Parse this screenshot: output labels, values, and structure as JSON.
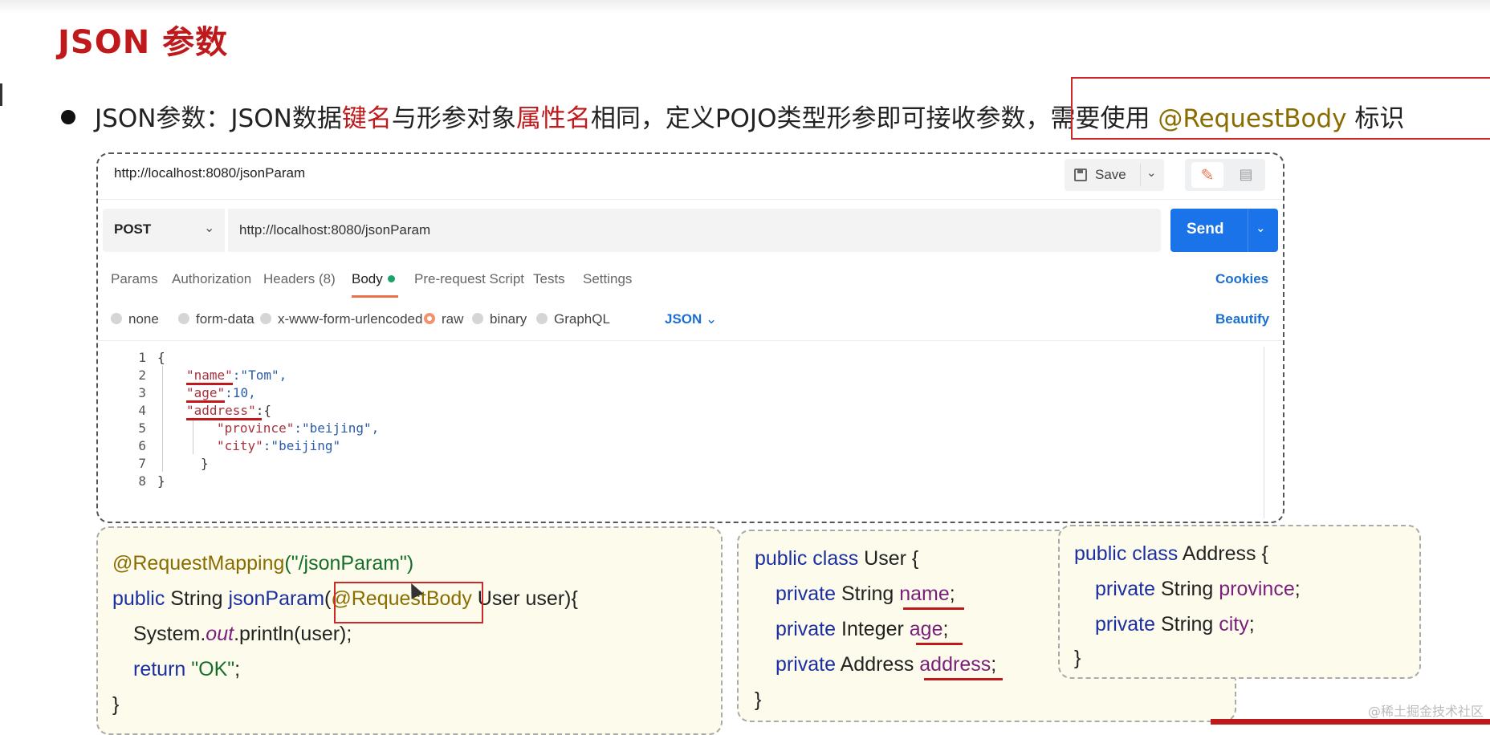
{
  "slide": {
    "title": "JSON 参数",
    "bullet": {
      "p1": "JSON参数：JSON数据",
      "p2": "键名",
      "p3": "与形参对象",
      "p4": "属性名",
      "p5": "相同，定义POJO类型形参即可接收参数，",
      "p6": "需要使用 ",
      "p7": "@RequestBody",
      "p8": " 标识"
    }
  },
  "postman": {
    "request_title": "http://localhost:8080/jsonParam",
    "save_label": "Save",
    "method": "POST",
    "url": "http://localhost:8080/jsonParam",
    "send_label": "Send",
    "tabs": [
      "Params",
      "Authorization",
      "Headers (8)",
      "Body",
      "Pre-request Script",
      "Tests",
      "Settings"
    ],
    "active_tab": "Body",
    "cookies_label": "Cookies",
    "body_types": [
      "none",
      "form-data",
      "x-www-form-urlencoded",
      "raw",
      "binary",
      "GraphQL"
    ],
    "selected_body_type": "raw",
    "format": "JSON",
    "beautify_label": "Beautify",
    "code_lines": [
      {
        "n": "1",
        "text": "{"
      },
      {
        "n": "2",
        "key": "\"name\"",
        "rest": ":\"Tom\","
      },
      {
        "n": "3",
        "key": "\"age\"",
        "rest": ":10,"
      },
      {
        "n": "4",
        "key": "\"address\"",
        "rest": ":{"
      },
      {
        "n": "5",
        "key": "\"province\"",
        "rest": ":\"beijing\","
      },
      {
        "n": "6",
        "key": "\"city\"",
        "rest": ":\"beijing\""
      },
      {
        "n": "7",
        "text": "}"
      },
      {
        "n": "8",
        "text": "}"
      }
    ]
  },
  "controller_code": {
    "l1_ann": "@RequestMapping",
    "l1_str": "(\"/jsonParam\")",
    "l2_kw": "public",
    "l2_type": " String ",
    "l2_fn": "jsonParam",
    "l2_paren": "(",
    "l2_ann": "@RequestBody",
    "l2_rest": " User user){",
    "l3_a": "System.",
    "l3_it": "out",
    "l3_b": ".println(user);",
    "l4_kw": "return",
    "l4_str": " \"OK\"",
    "l4_end": ";",
    "l5": "}"
  },
  "user_class": {
    "l1_kw": "public class",
    "l1_rest": " User {",
    "f1_kw": "private",
    "f1_type": " String ",
    "f1_name": "name",
    "f2_kw": "private",
    "f2_type": " Integer ",
    "f2_name": "age",
    "f3_kw": "private",
    "f3_type": " Address ",
    "f3_name": "address",
    "end": "}"
  },
  "address_class": {
    "l1_kw": "public class",
    "l1_rest": " Address {",
    "f1_kw": "private",
    "f1_type": " String ",
    "f1_name": "province",
    "f2_kw": "private",
    "f2_type": " String ",
    "f2_name": "city",
    "end": "}"
  },
  "watermark": "@稀土掘金技术社区",
  "colors": {
    "title_red": "#c0191b",
    "annotation_olive": "#8a6d00",
    "send_blue": "#1a73e8",
    "active_orange": "#e8734a"
  }
}
